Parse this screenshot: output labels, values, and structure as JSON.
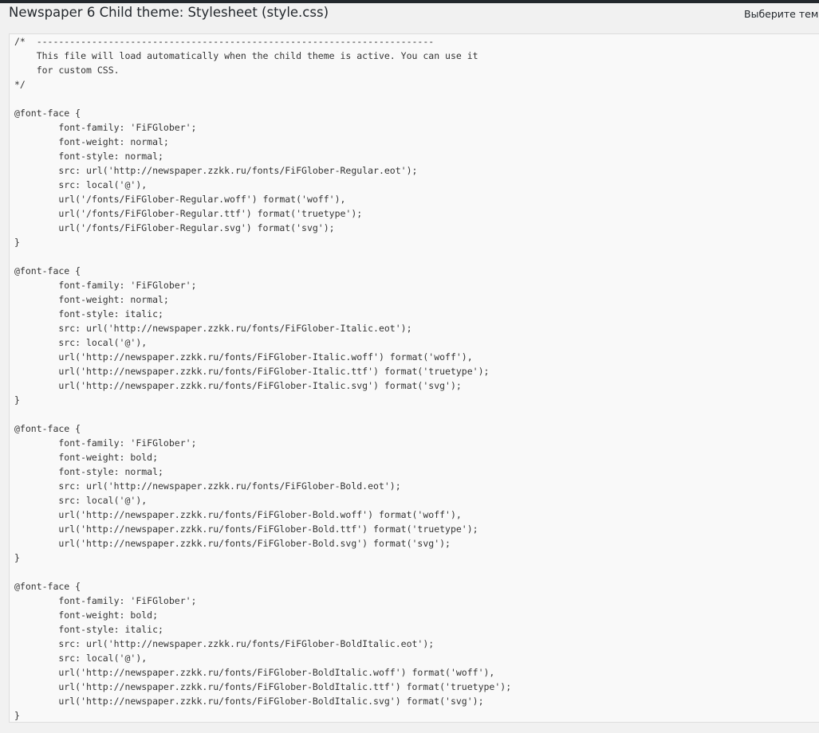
{
  "page": {
    "title": "Newspaper 6 Child theme: Stylesheet (style.css)",
    "theme_select_label": "Выберите тем"
  },
  "editor": {
    "content": "/*  ------------------------------------------------------------------------\n    This file will load automatically when the child theme is active. You can use it\n    for custom CSS.\n*/\n\n@font-face {\n        font-family: 'FiFGlober';\n        font-weight: normal;\n        font-style: normal;\n        src: url('http://newspaper.zzkk.ru/fonts/FiFGlober-Regular.eot');\n        src: local('@'),\n        url('/fonts/FiFGlober-Regular.woff') format('woff'),\n        url('/fonts/FiFGlober-Regular.ttf') format('truetype');\n        url('/fonts/FiFGlober-Regular.svg') format('svg');\n}\n\n@font-face {\n        font-family: 'FiFGlober';\n        font-weight: normal;\n        font-style: italic;\n        src: url('http://newspaper.zzkk.ru/fonts/FiFGlober-Italic.eot');\n        src: local('@'),\n        url('http://newspaper.zzkk.ru/fonts/FiFGlober-Italic.woff') format('woff'),\n        url('http://newspaper.zzkk.ru/fonts/FiFGlober-Italic.ttf') format('truetype');\n        url('http://newspaper.zzkk.ru/fonts/FiFGlober-Italic.svg') format('svg');\n}\n\n@font-face {\n        font-family: 'FiFGlober';\n        font-weight: bold;\n        font-style: normal;\n        src: url('http://newspaper.zzkk.ru/fonts/FiFGlober-Bold.eot');\n        src: local('@'),\n        url('http://newspaper.zzkk.ru/fonts/FiFGlober-Bold.woff') format('woff'),\n        url('http://newspaper.zzkk.ru/fonts/FiFGlober-Bold.ttf') format('truetype');\n        url('http://newspaper.zzkk.ru/fonts/FiFGlober-Bold.svg') format('svg');\n}\n\n@font-face {\n        font-family: 'FiFGlober';\n        font-weight: bold;\n        font-style: italic;\n        src: url('http://newspaper.zzkk.ru/fonts/FiFGlober-BoldItalic.eot');\n        src: local('@'),\n        url('http://newspaper.zzkk.ru/fonts/FiFGlober-BoldItalic.woff') format('woff'),\n        url('http://newspaper.zzkk.ru/fonts/FiFGlober-BoldItalic.ttf') format('truetype');\n        url('http://newspaper.zzkk.ru/fonts/FiFGlober-BoldItalic.svg') format('svg');\n}"
  },
  "colors": {
    "admin_bar": "#23282d",
    "page_background": "#f1f1f1",
    "editor_background": "#f9f9f9",
    "editor_border": "#dddddd",
    "text": "#333333"
  }
}
